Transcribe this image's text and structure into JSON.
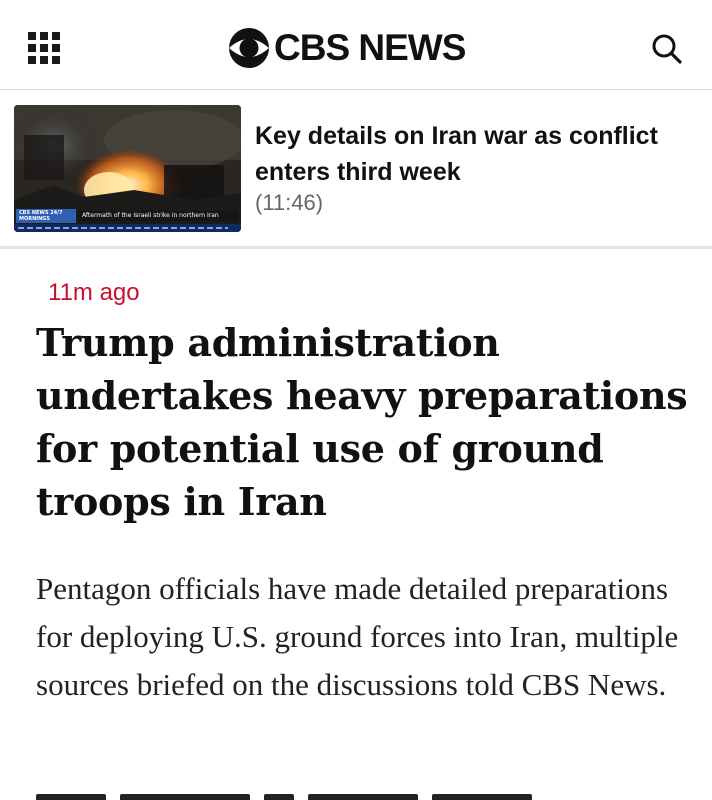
{
  "header": {
    "menu_icon": "grid-menu-icon",
    "logo_text": "CBS NEWS",
    "logo_icon": "cbs-eye-icon",
    "search_icon": "search-icon"
  },
  "video": {
    "title": "Key details on Iran war as conflict enters third week",
    "duration": "(11:46)",
    "thumbnail": {
      "brand": "CBS NEWS 24/7 MORNINGS",
      "lower_third": "Aftermath of the Israeli strike in northern Iran"
    }
  },
  "article": {
    "timestamp": "11m ago",
    "headline": "Trump administration undertakes heavy preparations for potential use of ground troops in Iran",
    "summary": "Pentagon officials have made detailed preparations for deploying U.S. ground forces into Iran, multiple sources briefed on the discussions told CBS News."
  },
  "colors": {
    "accent": "#c8102e",
    "text": "#111111",
    "muted": "#666666",
    "divider": "#e4e4e4"
  }
}
